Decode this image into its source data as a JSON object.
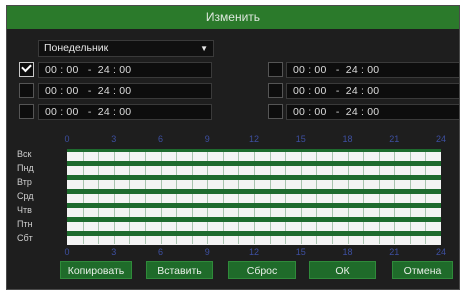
{
  "title": "Изменить",
  "day_select": {
    "value": "Понедельник"
  },
  "periods_left": [
    {
      "checked": true,
      "value": "00 : 00   -  24 : 00"
    },
    {
      "checked": false,
      "value": "00 : 00   -  24 : 00"
    },
    {
      "checked": false,
      "value": "00 : 00   -  24 : 00"
    }
  ],
  "periods_right": [
    {
      "checked": false,
      "value": "00 : 00   -  24 : 00"
    },
    {
      "checked": false,
      "value": "00 : 00   -  24 : 00"
    },
    {
      "checked": false,
      "value": "00 : 00   -  24 : 00"
    }
  ],
  "hour_ticks": [
    "0",
    "3",
    "6",
    "9",
    "12",
    "15",
    "18",
    "21",
    "24"
  ],
  "days": [
    "Вск",
    "Пнд",
    "Втр",
    "Срд",
    "Чтв",
    "Птн",
    "Сбт"
  ],
  "schedule_coverage": [
    1,
    1,
    1,
    1,
    1,
    1,
    1
  ],
  "buttons": {
    "copy": "Копировать",
    "paste": "Вставить",
    "reset": "Сброс",
    "ok": "ОК",
    "cancel": "Отмена"
  },
  "colors": {
    "accent": "#2b7a2b",
    "schedule_fill": "#f4f4f4",
    "tick_text": "#3d4fa0"
  }
}
